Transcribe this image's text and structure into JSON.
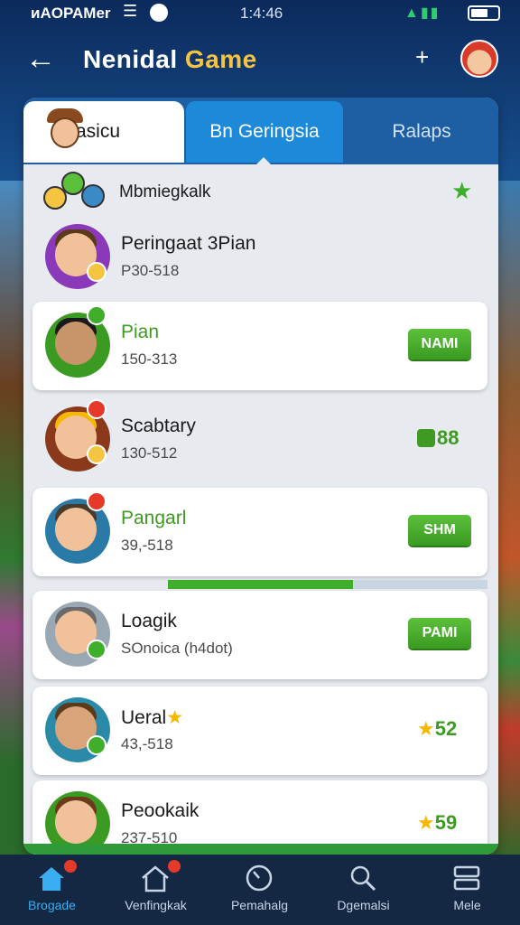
{
  "status_bar": {
    "carrier": "ᴎAOPAMer",
    "time": "1:4:46"
  },
  "header": {
    "title_main": "Nenidal",
    "title_accent": "Game"
  },
  "tabs": [
    "Pasicu",
    "Bn Geringsia",
    "Ralaps"
  ],
  "group": {
    "title": "Mbmiegkalk"
  },
  "rows": [
    {
      "name": "Peringaat 3Pian",
      "sub": "P30-518",
      "action": ""
    },
    {
      "name": "Pian",
      "sub": "150-313",
      "action": "NAMI"
    },
    {
      "name": "Scabtary",
      "sub": "130-512",
      "score": "88"
    },
    {
      "name": "Pangarl",
      "sub": "39,-518",
      "action": "SHM"
    },
    {
      "name": "Loagik",
      "sub": "SOnoica (h4dot)",
      "action": "PAMI"
    },
    {
      "name": "Ueral",
      "sub": "43,-518",
      "score": "52"
    },
    {
      "name": "Peookaik",
      "sub": "237-510",
      "score": "59"
    }
  ],
  "progress": {
    "value": 0.58
  },
  "bottom_nav": [
    {
      "label": "Brogade",
      "icon": "home-icon",
      "active": true
    },
    {
      "label": "Venfingkak",
      "icon": "house-badge-icon"
    },
    {
      "label": "Pemahalg",
      "icon": "clock-icon"
    },
    {
      "label": "Dgemalsi",
      "icon": "search-people-icon"
    },
    {
      "label": "Mele",
      "icon": "menu-icon"
    }
  ],
  "colors": {
    "accent_blue": "#1c8ad8",
    "accent_green": "#3fae2a",
    "title_accent": "#f5c542"
  }
}
